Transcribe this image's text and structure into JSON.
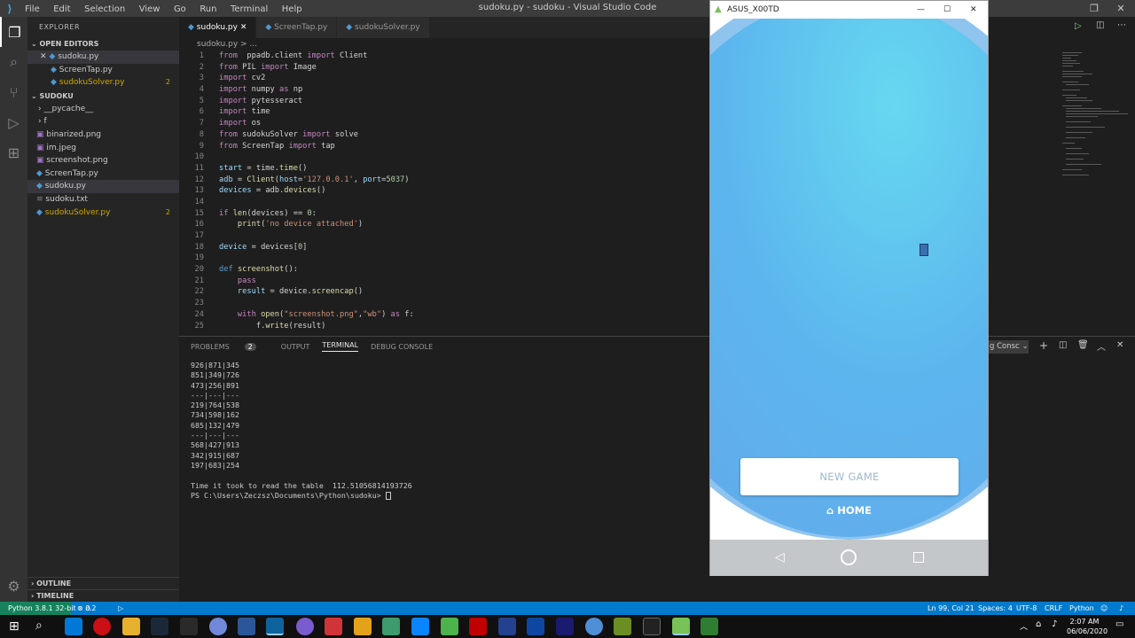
{
  "titlebar": {
    "menus": [
      "File",
      "Edit",
      "Selection",
      "View",
      "Go",
      "Run",
      "Terminal",
      "Help"
    ],
    "title": "sudoku.py - sudoku - Visual Studio Code"
  },
  "sidebar": {
    "header": "EXPLORER",
    "open_editors_label": "OPEN EDITORS",
    "open_editors": [
      {
        "name": "sudoku.py",
        "badge": ""
      },
      {
        "name": "ScreenTap.py",
        "badge": ""
      },
      {
        "name": "sudokuSolver.py",
        "badge": "2"
      }
    ],
    "folder_label": "SUDOKU",
    "files": [
      {
        "name": "__pycache__",
        "badge": ""
      },
      {
        "name": "f",
        "badge": ""
      },
      {
        "name": "binarized.png",
        "badge": ""
      },
      {
        "name": "im.jpeg",
        "badge": ""
      },
      {
        "name": "screenshot.png",
        "badge": ""
      },
      {
        "name": "ScreenTap.py",
        "badge": ""
      },
      {
        "name": "sudoku.py",
        "badge": ""
      },
      {
        "name": "sudoku.txt",
        "badge": ""
      },
      {
        "name": "sudokuSolver.py",
        "badge": "2"
      }
    ],
    "outline_label": "OUTLINE",
    "timeline_label": "TIMELINE"
  },
  "tabs": [
    "sudoku.py",
    "ScreenTap.py",
    "sudokuSolver.py"
  ],
  "breadcrumb": "sudoku.py > ...",
  "code": [
    [
      [
        "kw",
        "from"
      ],
      [
        "",
        "  ppadb.client "
      ],
      [
        "kw",
        "import"
      ],
      [
        "",
        " Client"
      ]
    ],
    [
      [
        "kw",
        "from"
      ],
      [
        "",
        " PIL "
      ],
      [
        "kw",
        "import"
      ],
      [
        "",
        " Image"
      ]
    ],
    [
      [
        "kw",
        "import"
      ],
      [
        "",
        " cv2"
      ]
    ],
    [
      [
        "kw",
        "import"
      ],
      [
        "",
        " numpy "
      ],
      [
        "kw",
        "as"
      ],
      [
        "",
        " np"
      ]
    ],
    [
      [
        "kw",
        "import"
      ],
      [
        "",
        " pytesseract"
      ]
    ],
    [
      [
        "kw",
        "import"
      ],
      [
        "",
        " time"
      ]
    ],
    [
      [
        "kw",
        "import"
      ],
      [
        "",
        " os"
      ]
    ],
    [
      [
        "kw",
        "from"
      ],
      [
        "",
        " sudokuSolver "
      ],
      [
        "kw",
        "import"
      ],
      [
        "",
        " solve"
      ]
    ],
    [
      [
        "kw",
        "from"
      ],
      [
        "",
        " ScreenTap "
      ],
      [
        "kw",
        "import"
      ],
      [
        "",
        " tap"
      ]
    ],
    [],
    [
      [
        "vr",
        "start"
      ],
      [
        "",
        " = time."
      ],
      [
        "fn",
        "time"
      ],
      [
        "",
        "()"
      ]
    ],
    [
      [
        "vr",
        "adb"
      ],
      [
        "",
        " = "
      ],
      [
        "fn",
        "Client"
      ],
      [
        "",
        "("
      ],
      [
        "vr",
        "host"
      ],
      [
        "",
        "="
      ],
      [
        "st",
        "'127.0.0.1'"
      ],
      [
        ", "
      ],
      [
        "vr",
        "port"
      ],
      [
        "",
        "="
      ],
      [
        "nm",
        "5037"
      ],
      [
        "",
        ")"
      ]
    ],
    [
      [
        "vr",
        "devices"
      ],
      [
        "",
        " = adb."
      ],
      [
        "fn",
        "devices"
      ],
      [
        "",
        "()"
      ]
    ],
    [],
    [
      [
        "kw",
        "if"
      ],
      [
        "",
        " "
      ],
      [
        "fn",
        "len"
      ],
      [
        "",
        "(devices) == "
      ],
      [
        "nm",
        "0"
      ],
      [
        "",
        ":"
      ]
    ],
    [
      [
        "",
        "    "
      ],
      [
        "fn",
        "print"
      ],
      [
        "",
        "("
      ],
      [
        "st",
        "'no device attached'"
      ],
      [
        "",
        ")"
      ]
    ],
    [],
    [
      [
        "vr",
        "device"
      ],
      [
        "",
        " = devices["
      ],
      [
        "nm",
        "0"
      ],
      [
        "",
        "]"
      ]
    ],
    [],
    [
      [
        "bl",
        "def"
      ],
      [
        "",
        " "
      ],
      [
        "fn",
        "screenshot"
      ],
      [
        "",
        "():"
      ]
    ],
    [
      [
        "",
        "    "
      ],
      [
        "kw",
        "pass"
      ]
    ],
    [
      [
        "",
        "    "
      ],
      [
        "vr",
        "result"
      ],
      [
        "",
        " = device."
      ],
      [
        "fn",
        "screencap"
      ],
      [
        "",
        "()"
      ]
    ],
    [],
    [
      [
        "",
        "    "
      ],
      [
        "kw",
        "with"
      ],
      [
        "",
        " "
      ],
      [
        "fn",
        "open"
      ],
      [
        "",
        "("
      ],
      [
        "st",
        "\"screenshot.png\""
      ],
      [
        "",
        ","
      ],
      [
        "st",
        "\"wb\""
      ],
      [
        "",
        ") "
      ],
      [
        "kw",
        "as"
      ],
      [
        "",
        " f:"
      ]
    ],
    [
      [
        "",
        "        f."
      ],
      [
        "fn",
        "write"
      ],
      [
        "",
        "(result)"
      ]
    ]
  ],
  "panel": {
    "tabs": [
      "PROBLEMS",
      "OUTPUT",
      "TERMINAL",
      "DEBUG CONSOLE"
    ],
    "problems_count": "2",
    "terminal_dropdown": "g Consc",
    "terminal_lines": [
      "926|871|345",
      "851|349|726",
      "473|256|891",
      "---|---|---",
      "219|764|538",
      "734|598|162",
      "685|132|479",
      "---|---|---",
      "568|427|913",
      "342|915|687",
      "197|683|254",
      "",
      "Time it took to read the table  112.51056814193726",
      "PS C:\\Users\\Zeczsz\\Documents\\Python\\sudoku> "
    ]
  },
  "status": {
    "python": "Python 3.8.1 32-bit",
    "errors": "0",
    "warnings": "2",
    "position": "Ln 99, Col 21",
    "spaces": "Spaces: 4",
    "encoding": "UTF-8",
    "eol": "CRLF",
    "language": "Python"
  },
  "phone": {
    "title": "ASUS_X00TD",
    "new_game": "NEW GAME",
    "home": "HOME",
    "accent": "#5cb6ee"
  },
  "taskbar": {
    "time": "2:07 AM",
    "date": "06/06/2020"
  }
}
